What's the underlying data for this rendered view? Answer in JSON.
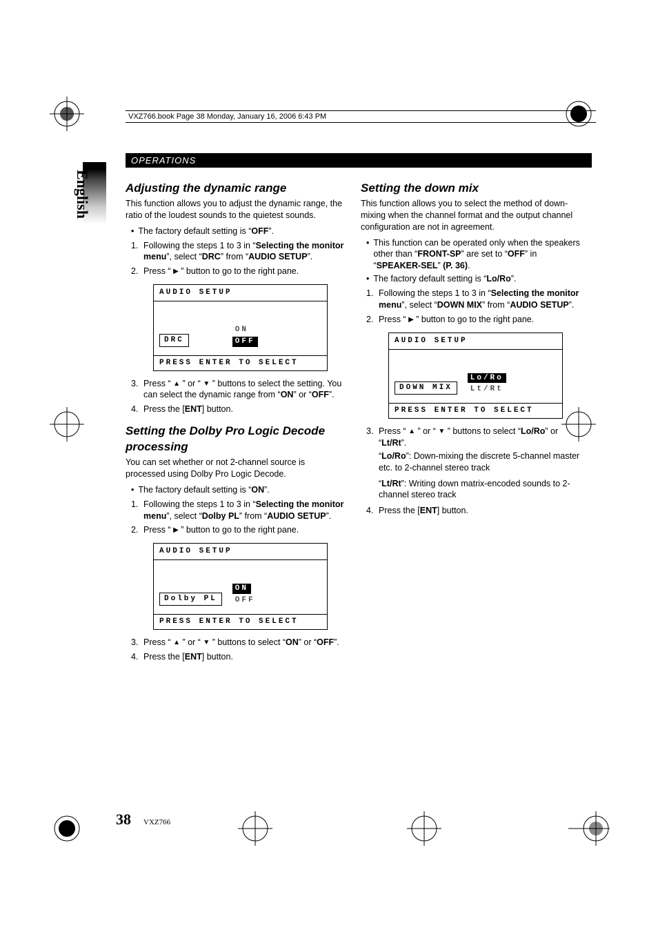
{
  "print_header": "VXZ766.book  Page 38  Monday, January 16, 2006  6:43 PM",
  "section_title": "OPERATIONS",
  "language": "English",
  "page_number": "38",
  "model": "VXZ766",
  "glyphs": {
    "right": "▶",
    "up": "▲",
    "down": "▼"
  },
  "left_col": {
    "s1": {
      "heading": "Adjusting the dynamic range",
      "intro": "This function allows you to adjust the dynamic range, the ratio of the loudest sounds to the quietest sounds.",
      "bullet1_a": "The factory default setting is “",
      "bullet1_b": "OFF",
      "bullet1_c": "”.",
      "step1_a": "Following the steps 1 to 3 in “",
      "step1_b": "Selecting the monitor menu",
      "step1_c": "”, select “",
      "step1_d": "DRC",
      "step1_e": "” from “",
      "step1_f": "AUDIO SETUP",
      "step1_g": "”.",
      "step2_a": "Press “ ",
      "step2_b": " ” button to go to the right pane.",
      "osd": {
        "title": "AUDIO SETUP",
        "item": "DRC",
        "opt1": "ON",
        "opt2": "OFF",
        "footer": "PRESS ENTER TO SELECT"
      },
      "step3_a": "Press “ ",
      "step3_b": " ” or “ ",
      "step3_c": " ” buttons to select the setting. You can select the dynamic range from “",
      "step3_d": "ON",
      "step3_e": "” or “",
      "step3_f": "OFF",
      "step3_g": "”.",
      "step4_a": "Press the [",
      "step4_b": "ENT",
      "step4_c": "] button."
    },
    "s2": {
      "heading": "Setting the Dolby Pro Logic Decode processing",
      "intro": "You can set whether or not 2-channel source is processed using Dolby Pro Logic Decode.",
      "bullet1_a": "The factory default setting is “",
      "bullet1_b": "ON",
      "bullet1_c": "”.",
      "step1_a": "Following the steps 1 to 3 in “",
      "step1_b": "Selecting the monitor menu",
      "step1_c": "”, select “",
      "step1_d": "Dolby PL",
      "step1_e": "” from “",
      "step1_f": "AUDIO SETUP",
      "step1_g": "”.",
      "step2_a": "Press “ ",
      "step2_b": " ” button to go to the right pane.",
      "osd": {
        "title": "AUDIO SETUP",
        "item": "Dolby PL",
        "opt1": "ON",
        "opt2": "OFF",
        "footer": "PRESS ENTER TO SELECT"
      },
      "step3_a": "Press “ ",
      "step3_b": " ” or “ ",
      "step3_c": " ” buttons to select “",
      "step3_d": "ON",
      "step3_e": "” or “",
      "step3_f": "OFF",
      "step3_g": "”.",
      "step4_a": "Press the [",
      "step4_b": "ENT",
      "step4_c": "] button."
    }
  },
  "right_col": {
    "s1": {
      "heading": "Setting the down mix",
      "intro": "This function allows you to select the method of down-mixing when the channel format and the output channel configuration are not in agreement.",
      "bullet1_a": "This function can be operated only when the speakers other than “",
      "bullet1_b": "FRONT-SP",
      "bullet1_c": "” are set to “",
      "bullet1_d": "OFF",
      "bullet1_e": "” in “",
      "bullet1_f": "SPEAKER-SEL",
      "bullet1_g": "” ",
      "bullet1_h": "(P. 36)",
      "bullet1_i": ".",
      "bullet2_a": "The factory default setting is “",
      "bullet2_b": "Lo/Ro",
      "bullet2_c": "”.",
      "step1_a": "Following the steps 1 to 3 in “",
      "step1_b": "Selecting the monitor menu",
      "step1_c": "”, select “",
      "step1_d": "DOWN MIX",
      "step1_e": "” from “",
      "step1_f": "AUDIO SETUP",
      "step1_g": "”.",
      "step2_a": "Press “ ",
      "step2_b": " ” button to go to the right pane.",
      "osd": {
        "title": "AUDIO SETUP",
        "item": "DOWN MIX",
        "opt1": "Lo/Ro",
        "opt2": "Lt/Rt",
        "footer": "PRESS ENTER TO SELECT"
      },
      "step3_a": "Press “ ",
      "step3_b": " ” or “ ",
      "step3_c": " ” buttons to select “",
      "step3_d": "Lo/Ro",
      "step3_e": "” or “",
      "step3_f": "Lt/Rt",
      "step3_g": "”.",
      "note1_a": "“",
      "note1_b": "Lo/Ro",
      "note1_c": "”: Down-mixing the discrete 5-channel master etc. to 2-channel stereo track",
      "note2_a": "“",
      "note2_b": "Lt/Rt",
      "note2_c": "”: Writing down matrix-encoded sounds to 2-channel stereo track",
      "step4_a": "Press the [",
      "step4_b": "ENT",
      "step4_c": "] button."
    }
  }
}
